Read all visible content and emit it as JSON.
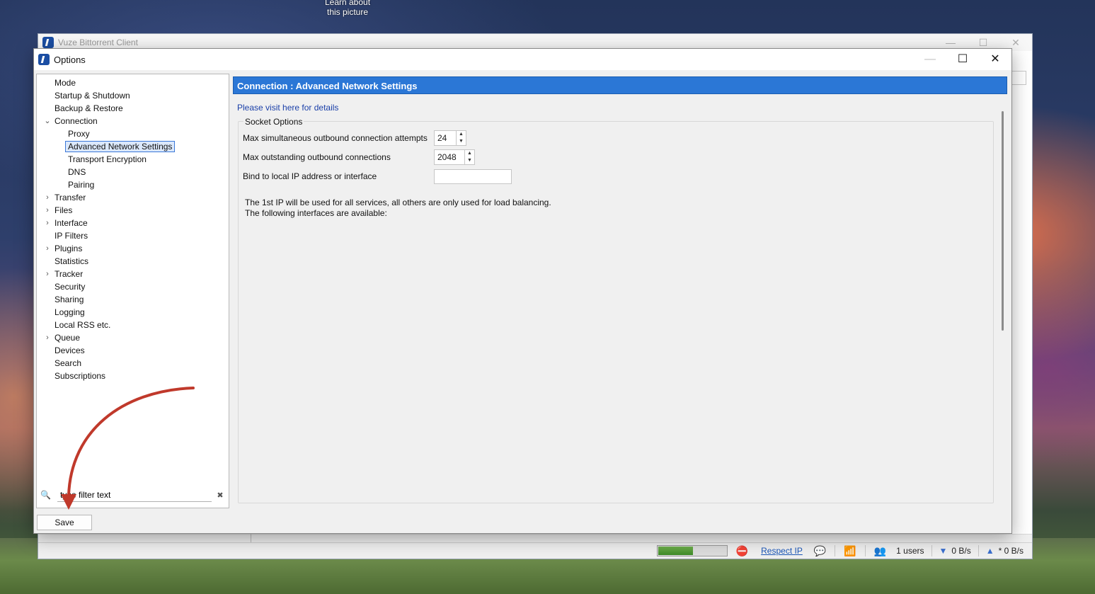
{
  "desktop": {
    "caption": "Learn about\nthis picture"
  },
  "main_window": {
    "title": "Vuze Bittorrent Client",
    "controls": {
      "minimize": "—",
      "maximize": "☐",
      "close": "✕"
    }
  },
  "statusbar": {
    "respect_ip": "Respect IP",
    "users": "1 users",
    "down_speed": "0 B/s",
    "up_speed": "* 0 B/s",
    "progress_fraction": 0.5
  },
  "options_window": {
    "title": "Options",
    "controls": {
      "minimize": "—",
      "maximize": "☐",
      "close": "✕"
    }
  },
  "tree": {
    "items": [
      {
        "label": "Mode",
        "level": 0,
        "arrow": ""
      },
      {
        "label": "Startup & Shutdown",
        "level": 0,
        "arrow": ""
      },
      {
        "label": "Backup & Restore",
        "level": 0,
        "arrow": ""
      },
      {
        "label": "Connection",
        "level": 0,
        "arrow": "⌄"
      },
      {
        "label": "Proxy",
        "level": 1,
        "arrow": ""
      },
      {
        "label": "Advanced Network Settings",
        "level": 1,
        "arrow": "",
        "selected": true
      },
      {
        "label": "Transport Encryption",
        "level": 1,
        "arrow": ""
      },
      {
        "label": "DNS",
        "level": 1,
        "arrow": ""
      },
      {
        "label": "Pairing",
        "level": 1,
        "arrow": ""
      },
      {
        "label": "Transfer",
        "level": 0,
        "arrow": "›"
      },
      {
        "label": "Files",
        "level": 0,
        "arrow": "›"
      },
      {
        "label": "Interface",
        "level": 0,
        "arrow": "›"
      },
      {
        "label": "IP Filters",
        "level": 0,
        "arrow": ""
      },
      {
        "label": "Plugins",
        "level": 0,
        "arrow": "›"
      },
      {
        "label": "Statistics",
        "level": 0,
        "arrow": ""
      },
      {
        "label": "Tracker",
        "level": 0,
        "arrow": "›"
      },
      {
        "label": "Security",
        "level": 0,
        "arrow": ""
      },
      {
        "label": "Sharing",
        "level": 0,
        "arrow": ""
      },
      {
        "label": "Logging",
        "level": 0,
        "arrow": ""
      },
      {
        "label": "Local RSS etc.",
        "level": 0,
        "arrow": ""
      },
      {
        "label": "Queue",
        "level": 0,
        "arrow": "›"
      },
      {
        "label": "Devices",
        "level": 0,
        "arrow": ""
      },
      {
        "label": "Search",
        "level": 0,
        "arrow": ""
      },
      {
        "label": "Subscriptions",
        "level": 0,
        "arrow": ""
      }
    ],
    "filter_value": "type filter text",
    "filter_clear": "✖"
  },
  "save_label": "Save",
  "content": {
    "header": "Connection : Advanced Network Settings",
    "details_link": "Please visit here for details",
    "socket_group_title": "Socket Options",
    "settings": {
      "max_attempts": {
        "label": "Max simultaneous outbound connection attempts",
        "value": "24"
      },
      "max_outstanding": {
        "label": "Max outstanding outbound connections",
        "value": "2048"
      },
      "bind_ip": {
        "label": "Bind to local IP address or interface",
        "value": ""
      }
    },
    "info_line1": "The 1st IP will be used for all services, all others are only used for load balancing.",
    "info_line2": "The following interfaces are available:"
  },
  "annotation": {
    "arrow_color": "#c0392b"
  }
}
